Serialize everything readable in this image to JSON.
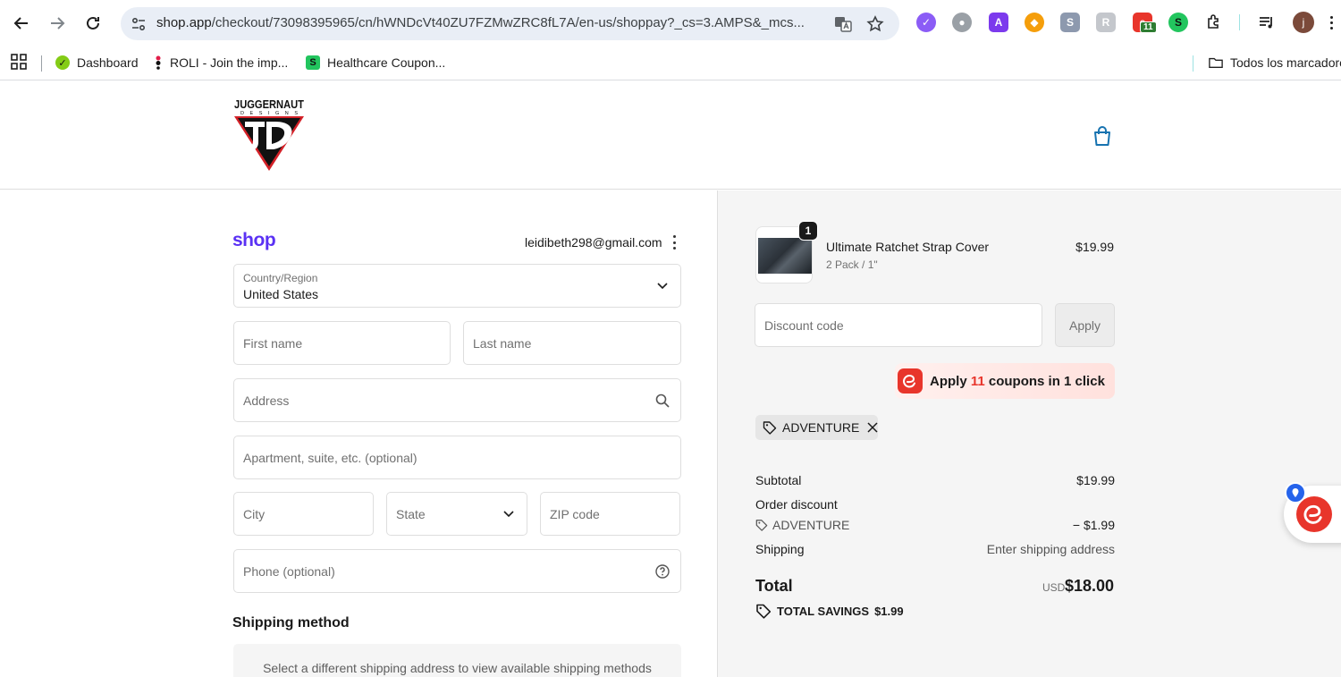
{
  "browser": {
    "url_host": "shop.app",
    "url_path": "/checkout/73098395965/cn/hWNDcVt40ZU7FZMwZRC8fL7A/en-us/shoppay?_cs=3.AMPS&_mcs...",
    "extension_badge_count": "11",
    "profile_initial": "j",
    "bookmarks": [
      {
        "label": "Dashboard"
      },
      {
        "label": "ROLI - Join the imp..."
      },
      {
        "label": "Healthcare Coupon..."
      }
    ],
    "bookmarks_folder": "Todos los marcadores"
  },
  "store": {
    "logo_text_top": "JUGGERNAUT",
    "logo_text_sub": "DESIGNS"
  },
  "checkout": {
    "shop_logo": "shop",
    "email": "leidibeth298@gmail.com",
    "country_label": "Country/Region",
    "country_value": "United States",
    "first_name_placeholder": "First name",
    "last_name_placeholder": "Last name",
    "address_placeholder": "Address",
    "apartment_placeholder": "Apartment, suite, etc. (optional)",
    "city_placeholder": "City",
    "state_placeholder": "State",
    "zip_placeholder": "ZIP code",
    "phone_placeholder": "Phone (optional)",
    "shipping_method_title": "Shipping method",
    "shipping_method_note": "Select a different shipping address to view available shipping methods"
  },
  "summary": {
    "product": {
      "quantity": "1",
      "name": "Ultimate Ratchet Strap Cover",
      "variant": "2 Pack / 1\"",
      "price": "$19.99"
    },
    "discount_placeholder": "Discount code",
    "apply_label": "Apply",
    "coupon_prefix": "Apply ",
    "coupon_count": "11",
    "coupon_suffix": " coupons in 1 click",
    "applied_code": "ADVENTURE",
    "subtotal_label": "Subtotal",
    "subtotal_value": "$19.99",
    "order_discount_label": "Order discount",
    "discount_code": "ADVENTURE",
    "discount_value": "− $1.99",
    "shipping_label": "Shipping",
    "shipping_value": "Enter shipping address",
    "total_label": "Total",
    "total_currency": "USD",
    "total_value": "$18.00",
    "savings_label": "TOTAL SAVINGS",
    "savings_value": "$1.99"
  },
  "colors": {
    "shop_brand": "#5a31f4",
    "coupon_red": "#e8352b",
    "cart_blue": "#1773b0"
  }
}
